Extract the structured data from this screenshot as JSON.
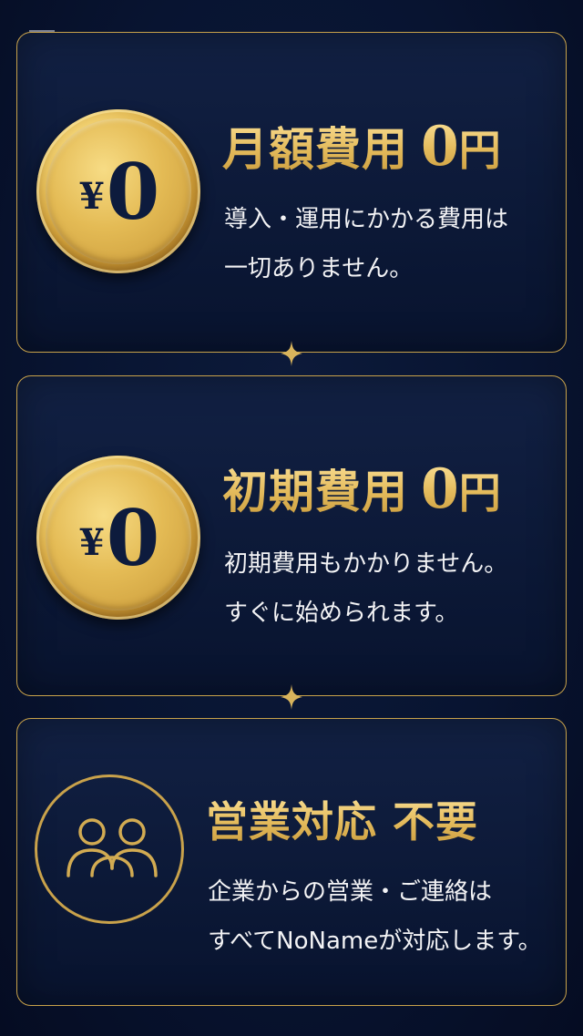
{
  "cards": [
    {
      "badge": {
        "symbol": "¥",
        "value": "0",
        "icon": "yen-coin-icon"
      },
      "title_main": "月額費用",
      "title_value": "0",
      "title_unit": "円",
      "lines": [
        "導入・運用にかかる費用は",
        "一切ありません。"
      ]
    },
    {
      "badge": {
        "symbol": "¥",
        "value": "0",
        "icon": "yen-coin-icon"
      },
      "title_main": "初期費用",
      "title_value": "0",
      "title_unit": "円",
      "lines": [
        "初期費用もかかりません。",
        "すぐに始められます。"
      ]
    },
    {
      "badge": {
        "icon": "people-icon"
      },
      "title": "営業対応 不要",
      "lines": [
        "企業からの営業・ご連絡は",
        "すべてNoNameが対応します。"
      ]
    }
  ],
  "colors": {
    "background": "#081431",
    "gold": "#c8a24a",
    "text": "#f3f3f5",
    "coin_text": "#0d1b3d"
  }
}
